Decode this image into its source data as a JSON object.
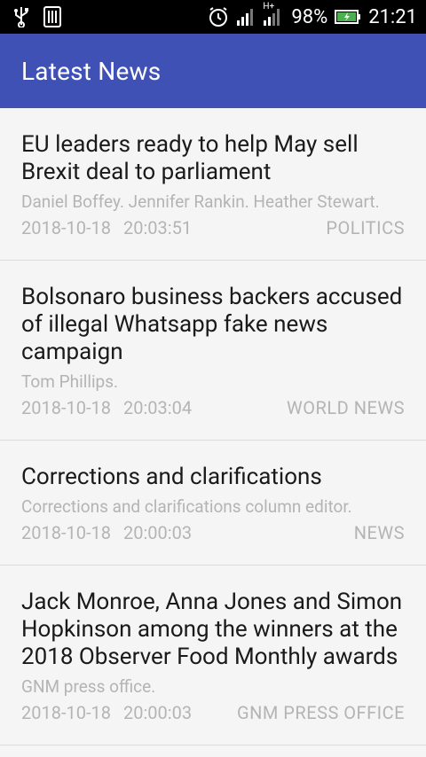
{
  "status_bar": {
    "battery": "98%",
    "time": "21:21",
    "network": "H+"
  },
  "app_bar": {
    "title": "Latest News"
  },
  "articles": [
    {
      "title": "EU leaders ready to help May sell Brexit deal to parliament",
      "author": "Daniel Boffey. Jennifer Rankin. Heather Stewart.",
      "date": "2018-10-18",
      "time": "20:03:51",
      "section": "POLITICS"
    },
    {
      "title": "Bolsonaro business backers accused of illegal Whatsapp fake news campaign",
      "author": "Tom Phillips.",
      "date": "2018-10-18",
      "time": "20:03:04",
      "section": "WORLD NEWS"
    },
    {
      "title": "Corrections and clarifications",
      "author": "Corrections and clarifications column editor.",
      "date": "2018-10-18",
      "time": "20:00:03",
      "section": "NEWS"
    },
    {
      "title": "Jack Monroe, Anna Jones and Simon Hopkinson among the winners at the 2018 Observer Food Monthly awards",
      "author": "GNM press office.",
      "date": "2018-10-18",
      "time": "20:00:03",
      "section": "GNM PRESS OFFICE"
    }
  ]
}
